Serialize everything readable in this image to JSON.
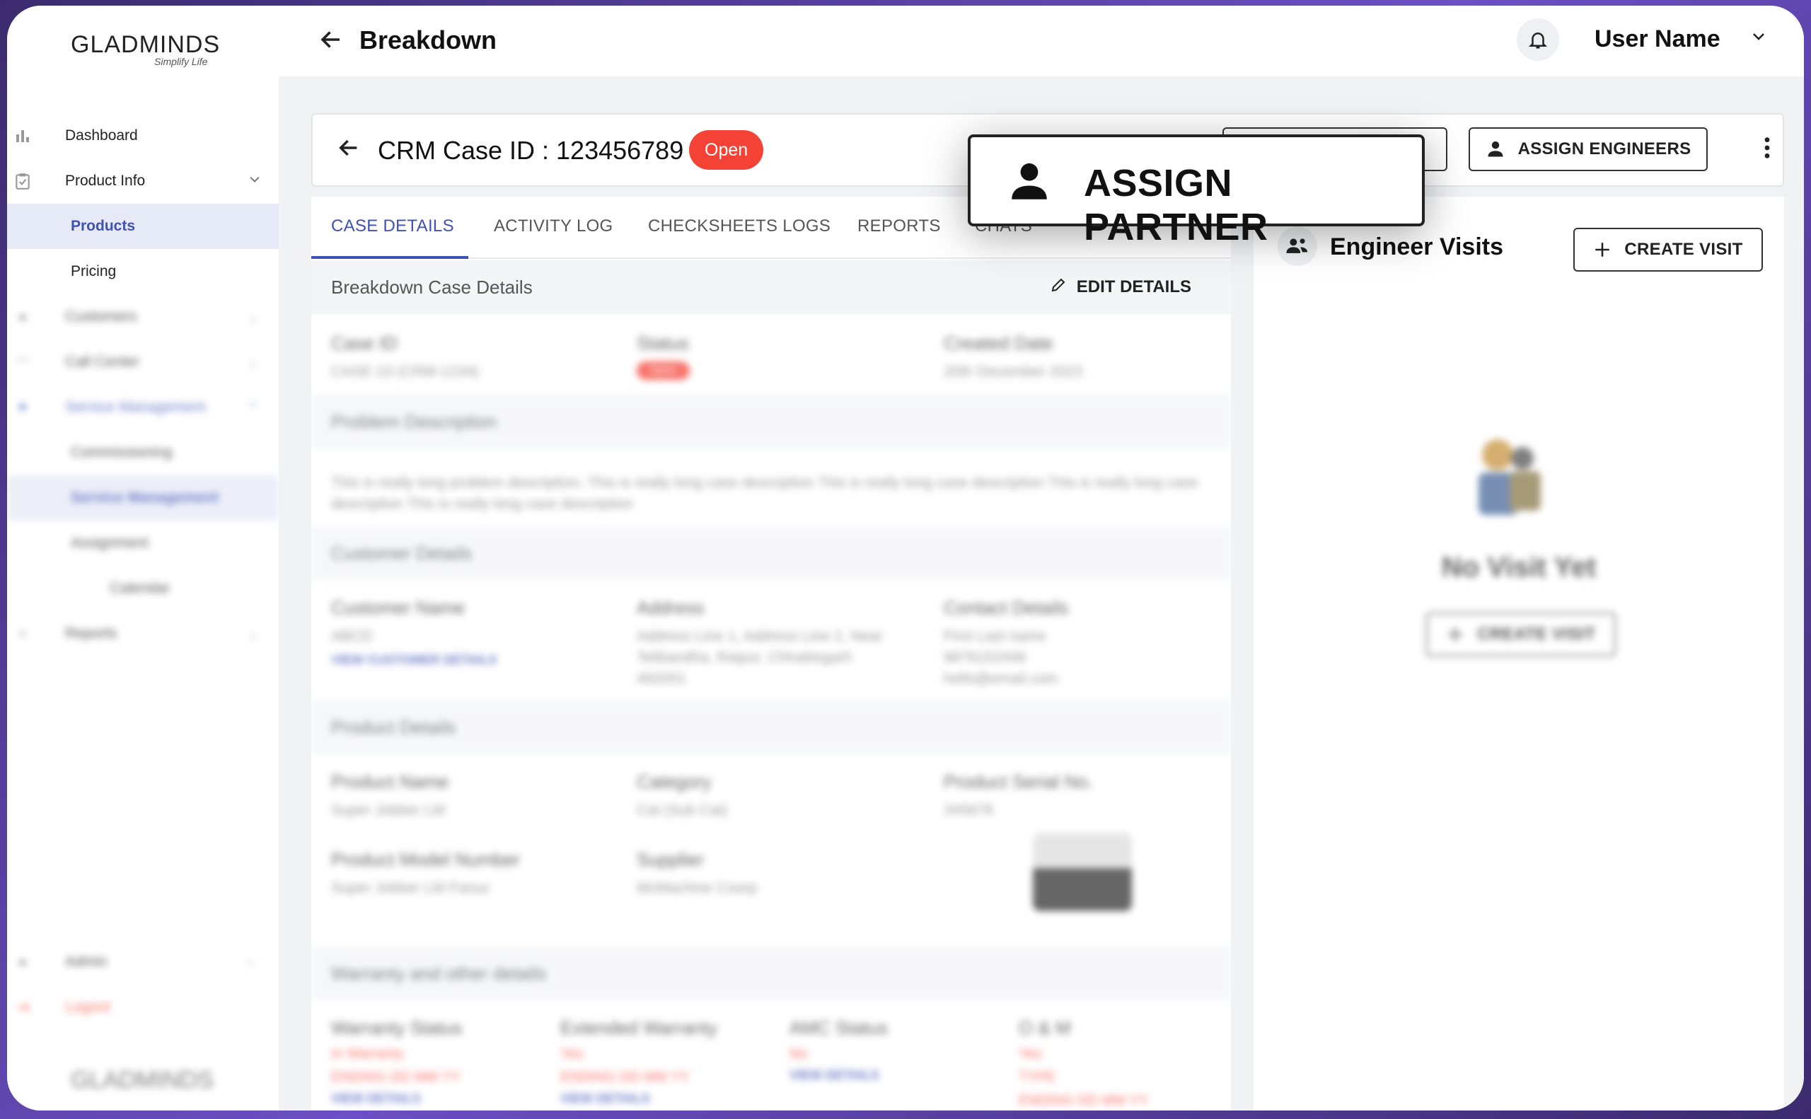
{
  "app": {
    "brand": "GLADMINDS",
    "tagline": "Simplify Life"
  },
  "header": {
    "title": "Breakdown",
    "user_name": "User Name"
  },
  "sidebar": {
    "items": [
      {
        "label": "Dashboard",
        "icon": "bar-chart-icon"
      },
      {
        "label": "Product Info",
        "icon": "clipboard-icon",
        "expanded": true
      },
      {
        "label": "Products",
        "sub": true,
        "active": true
      },
      {
        "label": "Pricing",
        "sub": true
      },
      {
        "label": "Customers",
        "icon": "people-icon"
      },
      {
        "label": "Call Center",
        "icon": "headset-icon"
      },
      {
        "label": "Service Management",
        "icon": "wrench-icon",
        "expanded": true
      },
      {
        "label": "Commissioning",
        "sub": true
      },
      {
        "label": "Service Management",
        "sub": true,
        "active": true
      },
      {
        "label": "Assignment",
        "sub": true
      },
      {
        "label": "Calendar",
        "sub": true
      },
      {
        "label": "Reports",
        "icon": "share-icon"
      },
      {
        "label": "Admin",
        "icon": "admin-icon"
      },
      {
        "label": "Logout",
        "icon": "logout-icon"
      }
    ],
    "footer_brand": "GLADMINDS"
  },
  "case": {
    "title": "CRM Case ID : 123456789",
    "status": "Open",
    "assign_partner_label": "ASSIGN PARTNER",
    "assign_engineers_label": "ASSIGN ENGINEERS"
  },
  "tabs": [
    "CASE DETAILS",
    "ACTIVITY LOG",
    "CHECKSHEETS LOGS",
    "REPORTS",
    "CHATS"
  ],
  "details": {
    "section_title": "Breakdown Case Details",
    "edit_label": "EDIT DETAILS",
    "case_id_label": "Case ID",
    "case_id_value": "CASE-10 (CRM-1234)",
    "status_label": "Status",
    "status_value": "Open",
    "created_label": "Created Date",
    "created_value": "20th December 2023",
    "problem_title": "Problem Description",
    "problem_text": "This is really long problem description, This is really long case description This is really long case description This is really long case description This is really long case description",
    "customer_title": "Customer Details",
    "customer_name_label": "Customer Name",
    "customer_name_value": "ABCD",
    "view_customer": "VIEW CUSTOMER DETAILS",
    "address_label": "Address",
    "address_value": "Address Line 1, Address Line 2, Near Telibandha, Raipur, Chhattisgarh 492001",
    "contact_label": "Contact Details",
    "contact_value": "First Last name 9876152446 hello@email.com",
    "product_title": "Product Details",
    "product_name_label": "Product Name",
    "product_name_value": "Super Jobber LM",
    "category_label": "Category",
    "category_value": "Cat (Sub Cat)",
    "serial_label": "Product Serial No.",
    "serial_value": "345678",
    "model_label": "Product Model Number",
    "model_value": "Super Jobber LM Fanuc",
    "supplier_label": "Supplier",
    "supplier_value": "McMachine Coorp",
    "warranty_title": "Warranty and other details",
    "warranty_status_label": "Warranty Status",
    "warranty_status_value": "In Warranty",
    "ext_warranty_label": "Extended Warranty",
    "ext_warranty_value": "Yes",
    "amc_label": "AMC Status",
    "amc_value": "No",
    "om_label": "O & M",
    "om_value": "Yes",
    "ending": "ENDING DD MM YY",
    "view_details": "VIEW DETAILS",
    "type": "TYPE"
  },
  "visits": {
    "title": "Engineer Visits",
    "create_label": "CREATE VISIT",
    "empty_text": "No Visit Yet"
  },
  "colors": {
    "primary": "#3f51b5",
    "danger": "#f44336",
    "frame": "#6b4fc4"
  }
}
